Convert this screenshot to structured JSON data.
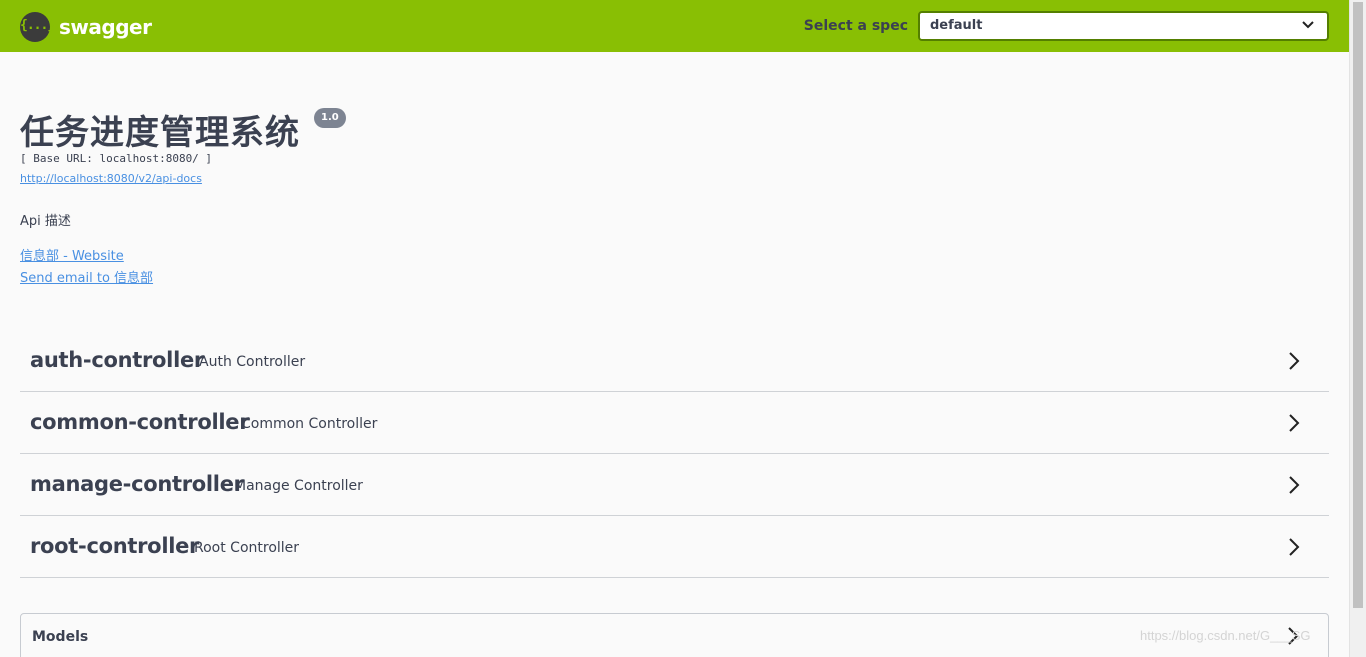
{
  "topbar": {
    "logo_text": "swagger",
    "logo_glyph": "{...}",
    "spec_label": "Select a spec",
    "spec_selected": "default"
  },
  "info": {
    "title": "任务进度管理系统",
    "version": "1.0",
    "base_url": "[ Base URL: localhost:8080/ ]",
    "docs_url": "http://localhost:8080/v2/api-docs",
    "description": "Api 描述",
    "contact_website": "信息部 - Website",
    "contact_email": "Send email to 信息部"
  },
  "tags": [
    {
      "name": "auth-controller",
      "description": "Auth Controller"
    },
    {
      "name": "common-controller",
      "description": "Common Controller"
    },
    {
      "name": "manage-controller",
      "description": "Manage Controller"
    },
    {
      "name": "root-controller",
      "description": "Root Controller"
    }
  ],
  "models": {
    "title": "Models"
  },
  "watermark": "https://blog.csdn.net/G___SG",
  "colors": {
    "topbar": "#89bf04",
    "link": "#4990e2",
    "text": "#3b4151",
    "version_badge": "#7d8492"
  }
}
